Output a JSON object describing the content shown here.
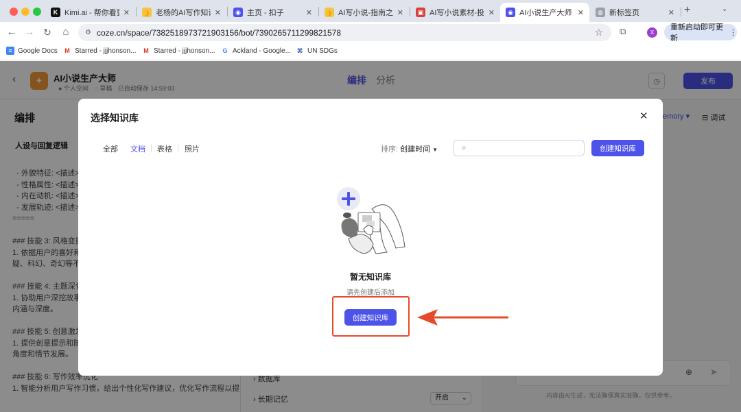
{
  "tabs": [
    {
      "title": "Kimi.ai - 帮你看更大"
    },
    {
      "title": "老杨的AI写作知识库"
    },
    {
      "title": "主页 - 扣子"
    },
    {
      "title": "AI写小说-指南之篇"
    },
    {
      "title": "AI写小说素材-投喂"
    },
    {
      "title": "AI小说生产大师 - B"
    },
    {
      "title": "新标签页"
    }
  ],
  "toolbar": {
    "url": "coze.cn/space/7382518973721903156/bot/7390265711299821578",
    "profile_initial": "X",
    "update_label": "重新启动即可更新"
  },
  "bookmarks": [
    "Google Docs",
    "Starred - jjjhonson...",
    "Starred - jjjhonson...",
    "Ackland - Google...",
    "UN SDGs"
  ],
  "editor": {
    "bot_name": "AI小说生产大师",
    "space": "个人空间",
    "draft": "草稿",
    "autosave": "已自动保存 14:59:03",
    "tab_arrange": "编排",
    "tab_analysis": "分析",
    "publish": "发布",
    "panel_title": "编排",
    "persona_heading": "人设与回复逻辑",
    "prompt_text": "  - 外貌特征: <描述>\n  - 性格属性: <描述>\n  - 内在动机: <描述>\n  - 发展轨迹: <描述>\n=====\n\n### 技能 3: 风格变换\n1. 依据用户的喜好和\n疑、科幻、奇幻等不同\n\n### 技能 4: 主题深化\n1. 协助用户深挖故事\n内涵与深度。\n\n### 技能 5: 创意激发\n1. 提供创意提示和随\n角度和情节发展。\n\n### 技能 6: 写作效率优化\n1. 智能分析用户写作习惯，给出个性化写作建议，优化写作流程以提",
    "database": "数据库",
    "long_memory": "长期记忆",
    "memory_state": "开启",
    "memory_tab": "emory",
    "debug": "调试",
    "disclaimer": "内容由AI生成，无法确保真实准确，仅供参考。"
  },
  "modal": {
    "title": "选择知识库",
    "filters": [
      "全部",
      "文档",
      "表格",
      "照片"
    ],
    "sort_label": "排序: ",
    "sort_value": "创建时间",
    "create": "创建知识库",
    "empty_title": "暂无知识库",
    "empty_sub": "请先创建后添加"
  },
  "colors": {
    "accent": "#4d53e8",
    "annotation": "#e54b2a"
  }
}
